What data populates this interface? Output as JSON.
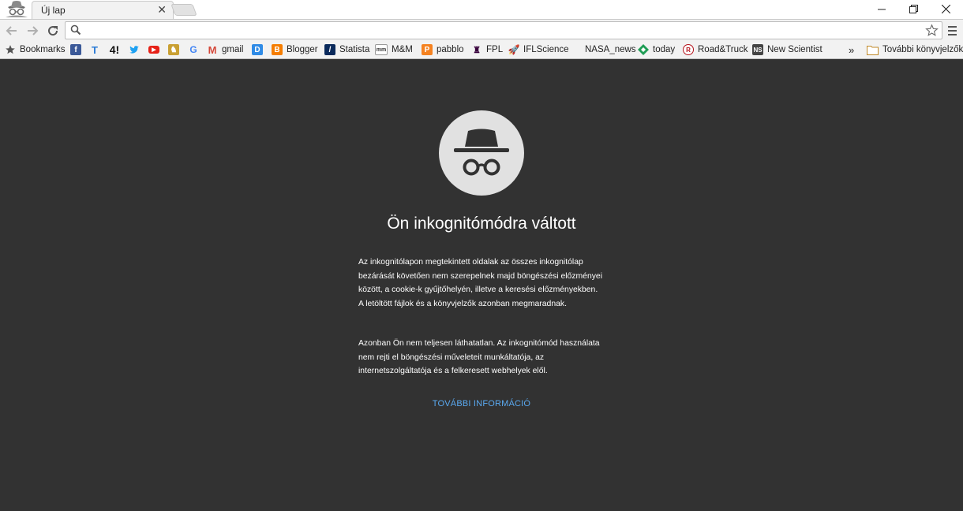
{
  "tab": {
    "title": "Új lap"
  },
  "window": {
    "minimize": "—",
    "restore": "❐",
    "close": "✕"
  },
  "omnibox": {
    "value": "",
    "placeholder": ""
  },
  "bookmarks": {
    "items": [
      {
        "label": "Bookmarks",
        "icon": "star-icon"
      },
      {
        "label": "",
        "icon": "facebook-icon"
      },
      {
        "label": "",
        "icon": "t-icon"
      },
      {
        "label": "",
        "icon": "h-icon"
      },
      {
        "label": "",
        "icon": "twitter-icon"
      },
      {
        "label": "",
        "icon": "youtube-icon"
      },
      {
        "label": "",
        "icon": "game-icon"
      },
      {
        "label": "",
        "icon": "google-icon"
      },
      {
        "label": "gmail",
        "icon": "gmail-icon"
      },
      {
        "label": "",
        "icon": "d-icon"
      },
      {
        "label": "Blogger",
        "icon": "blogger-icon"
      },
      {
        "label": "Statista",
        "icon": "statista-icon"
      },
      {
        "label": "M&M",
        "icon": "mm-icon"
      },
      {
        "label": "pabblo",
        "icon": "pabblo-icon"
      },
      {
        "label": "FPL",
        "icon": "fpl-icon"
      },
      {
        "label": "IFLScience",
        "icon": "rocket-icon"
      },
      {
        "label": "NASA_news",
        "icon": ""
      },
      {
        "label": "today",
        "icon": "today-icon"
      },
      {
        "label": "Road&Truck",
        "icon": "roadtruck-icon"
      },
      {
        "label": "New Scientist",
        "icon": "newscientist-icon"
      }
    ],
    "overflow": "»",
    "other": "További könyvjelzők"
  },
  "content": {
    "heading": "Ön inkognitómódra váltott",
    "paragraph1": "Az inkognitólapon megtekintett oldalak az összes inkognitólap bezárását követően nem szerepelnek majd böngészési előzményei között, a cookie-k gyűjtőhelyén, illetve a keresési előzményekben. A letöltött fájlok és a könyvjelzők azonban megmaradnak.",
    "paragraph2": "Azonban Ön nem teljesen láthatatlan. Az inkognitómód használata nem rejti el böngészési műveleteit munkáltatója, az internetszolgáltatója és a felkeresett webhelyek elől.",
    "learn_more": "TOVÁBBI INFORMÁCIÓ"
  },
  "colors": {
    "background": "#323232",
    "link": "#5aa9f0",
    "circle": "#e1e1e1"
  }
}
